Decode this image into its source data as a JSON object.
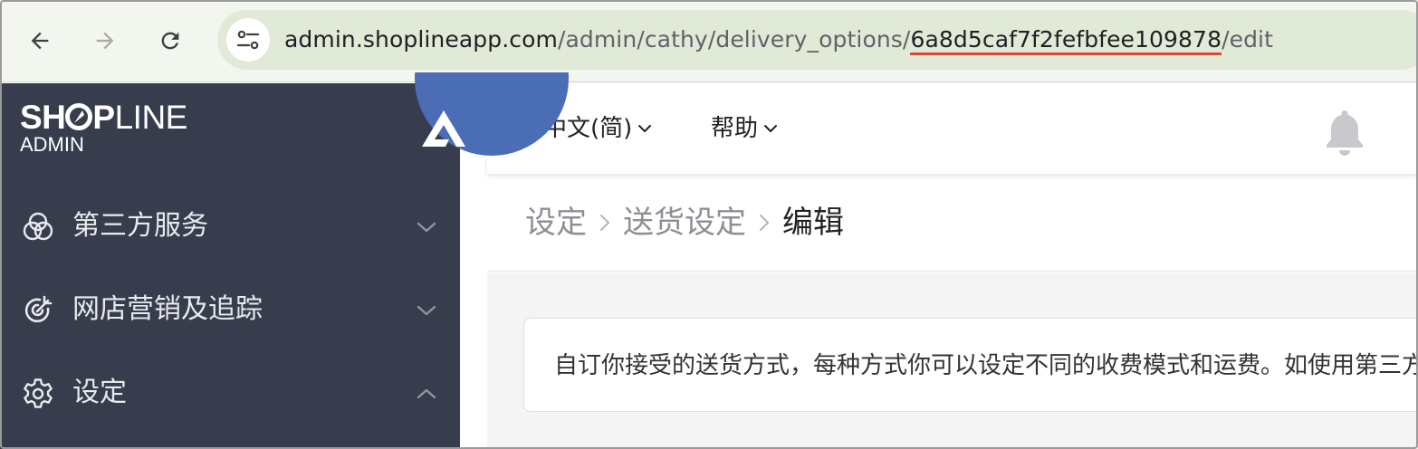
{
  "browser": {
    "url_host": "admin.shoplineapp.com",
    "url_path_before": "/admin/cathy/delivery_options/",
    "url_highlight": "6a8d5caf7f2fefbfee109878",
    "url_path_after": "/edit",
    "highlight_color": "#d84a3a"
  },
  "sidebar": {
    "brand_bold_1": "SH",
    "brand_bold_2": "P",
    "brand_light": "LINE",
    "admin_label": "ADMIN",
    "items": [
      {
        "label": "第三方服务",
        "icon": "overlapping-circles-icon",
        "expanded": false
      },
      {
        "label": "网店营销及追踪",
        "icon": "target-icon",
        "expanded": false
      },
      {
        "label": "设定",
        "icon": "gear-icon",
        "expanded": true
      }
    ]
  },
  "topbar": {
    "language": "中文(简)",
    "help": "帮助"
  },
  "breadcrumb": {
    "items": [
      "设定",
      "送货设定",
      "编辑"
    ]
  },
  "content": {
    "description": "自订你接受的送货方式，每种方式你可以设定不同的收费模式和运费。如使用第三方物流服务"
  },
  "colors": {
    "sidebar_bg": "#373d4c",
    "store_badge": "#4a6db5",
    "chrome_bg": "#f3f6ee",
    "omnibox_bg": "#e1e9d7"
  }
}
